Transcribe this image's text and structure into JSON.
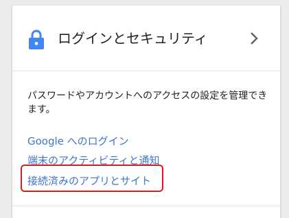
{
  "header": {
    "title": "ログインとセキュリティ",
    "icon": "lock-icon",
    "chevron_icon": "chevron-right-icon"
  },
  "description": "パスワードやアカウントへのアクセスの設定を管理できます。",
  "links": [
    "Google へのログイン",
    "端末のアクティビティと通知",
    "接続済みのアプリとサイト"
  ],
  "colors": {
    "link": "#3d75cf",
    "accent_icon": "#4285f4",
    "highlight": "#e5141b"
  }
}
